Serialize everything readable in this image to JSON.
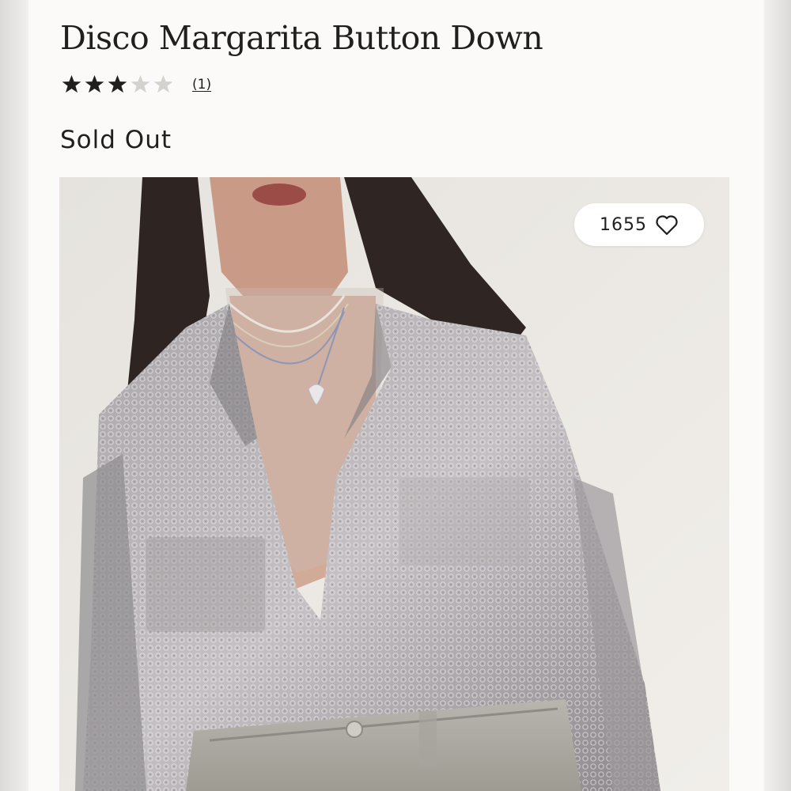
{
  "product": {
    "title": "Disco Margarita Button Down",
    "rating": {
      "value": 3,
      "max": 5,
      "review_count": "(1)"
    },
    "status": "Sold Out",
    "favorites": {
      "count": "1655",
      "icon": "heart-outline-icon"
    }
  },
  "colors": {
    "text": "#1f1f1f",
    "star_filled": "#1f1f1f",
    "star_empty": "#d4d2cf",
    "page_bg": "#fcfaf8",
    "pill_bg": "#ffffff"
  }
}
